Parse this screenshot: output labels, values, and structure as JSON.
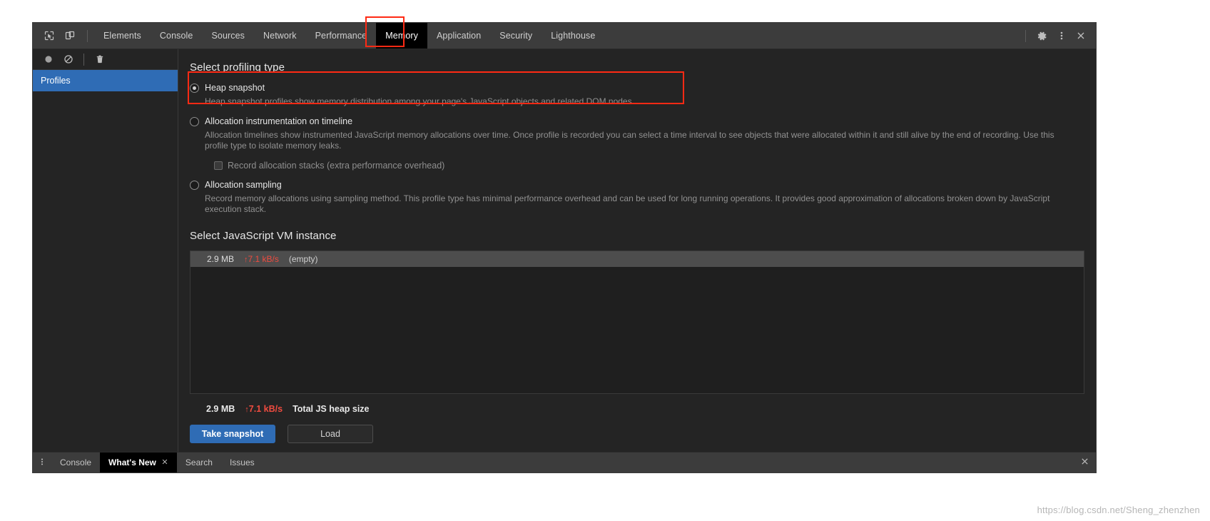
{
  "toolbar": {
    "inspect_icon": "inspect-element-icon",
    "device_icon": "device-toolbar-icon",
    "settings_icon": "gear-icon",
    "more_icon": "more-vertical-icon",
    "close_icon": "close-icon",
    "tabs": [
      {
        "label": "Elements",
        "active": false
      },
      {
        "label": "Console",
        "active": false
      },
      {
        "label": "Sources",
        "active": false
      },
      {
        "label": "Network",
        "active": false
      },
      {
        "label": "Performance",
        "active": false
      },
      {
        "label": "Memory",
        "active": true
      },
      {
        "label": "Application",
        "active": false
      },
      {
        "label": "Security",
        "active": false
      },
      {
        "label": "Lighthouse",
        "active": false
      }
    ]
  },
  "sidebar": {
    "record_icon": "record-circle-icon",
    "clear_icon": "clear-no-entry-icon",
    "delete_icon": "trash-icon",
    "items": [
      {
        "label": "Profiles",
        "selected": true
      }
    ]
  },
  "main": {
    "profiling_title": "Select profiling type",
    "vm_title": "Select JavaScript VM instance",
    "options": [
      {
        "label": "Heap snapshot",
        "selected": true,
        "desc": "Heap snapshot profiles show memory distribution among your page's JavaScript objects and related DOM nodes."
      },
      {
        "label": "Allocation instrumentation on timeline",
        "selected": false,
        "desc": "Allocation timelines show instrumented JavaScript memory allocations over time. Once profile is recorded you can select a time interval to see objects that were allocated within it and still alive by the end of recording. Use this profile type to isolate memory leaks."
      },
      {
        "label": "Allocation sampling",
        "selected": false,
        "desc": "Record memory allocations using sampling method. This profile type has minimal performance overhead and can be used for long running operations. It provides good approximation of allocations broken down by JavaScript execution stack."
      }
    ],
    "checkbox": {
      "label": "Record allocation stacks (extra performance overhead)",
      "checked": false
    },
    "vm_row": {
      "size": "2.9 MB",
      "rate": "7.1 kB/s",
      "arrow": "↑",
      "name": "(empty)"
    },
    "heap_summary": {
      "size": "2.9 MB",
      "rate": "7.1 kB/s",
      "arrow": "↑",
      "label": "Total JS heap size"
    },
    "buttons": {
      "take_snapshot": "Take snapshot",
      "load": "Load"
    }
  },
  "drawer": {
    "menu_icon": "more-vertical-icon",
    "close_icon": "close-icon",
    "tabs": [
      {
        "label": "Console",
        "active": false,
        "closable": false
      },
      {
        "label": "What's New",
        "active": true,
        "closable": true
      },
      {
        "label": "Search",
        "active": false,
        "closable": false
      },
      {
        "label": "Issues",
        "active": false,
        "closable": false
      }
    ]
  },
  "watermark": "https://blog.csdn.net/Sheng_zhenzhen",
  "colors": {
    "accent_blue": "#2f6cb5",
    "alert_red": "#ef4b3f",
    "annotation_red": "#ff2a14",
    "panel_bg": "#242424",
    "toolbar_bg": "#3c3c3c"
  }
}
